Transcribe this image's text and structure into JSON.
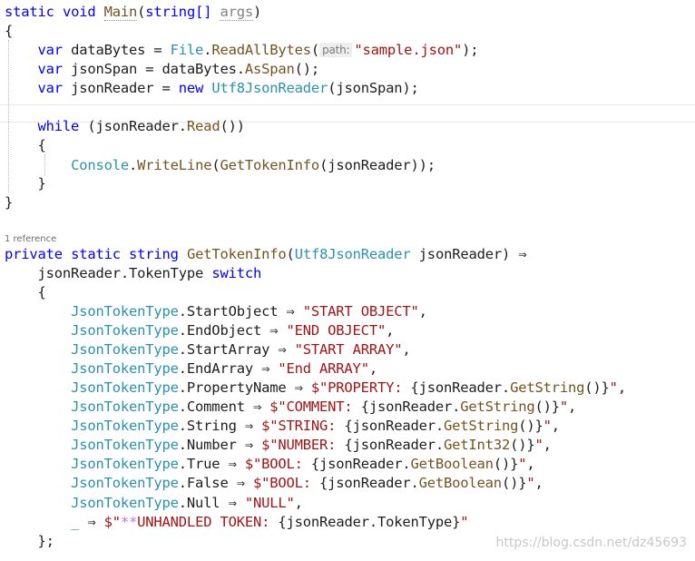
{
  "editor": {
    "main": {
      "sig": {
        "static": "static",
        "void": "void",
        "name": "Main",
        "open": "(",
        "type": "string[]",
        "param": "args",
        "close": ")"
      },
      "brace_open": "{",
      "l1": {
        "var": "var",
        "name": " dataBytes = ",
        "type": "File",
        "dot": ".",
        "method": "ReadAllBytes",
        "open": "(",
        "hint": "path:",
        "arg": "\"sample.json\"",
        "close": ");"
      },
      "l2": {
        "var": "var",
        "name": " jsonSpan = dataBytes.",
        "method": "AsSpan",
        "rest": "();"
      },
      "l3": {
        "var": "var",
        "name": " jsonReader = ",
        "new": "new",
        "type": "Utf8JsonReader",
        "rest": "(jsonSpan);"
      },
      "while": {
        "kw": "while",
        "open": " (jsonReader.",
        "method": "Read",
        "rest": "())"
      },
      "loop_open": "{",
      "console": {
        "type": "Console",
        "dot": ".",
        "method": "WriteLine",
        "open": "(",
        "call": "GetTokenInfo",
        "rest": "(jsonReader));"
      },
      "loop_close": "}",
      "brace_close": "}"
    },
    "codelens": "1 reference",
    "gti": {
      "sig": {
        "private": "private",
        "static": "static",
        "string": "string",
        "name": "GetTokenInfo",
        "open": "(",
        "type": "Utf8JsonReader",
        "rest": " jsonReader) ⇒"
      },
      "switch": {
        "expr": "jsonReader.TokenType ",
        "kw": "switch"
      },
      "open": "{",
      "arms": [
        {
          "type": "JsonTokenType",
          "member": ".StartObject ⇒ ",
          "prefix": "",
          "text": "\"START OBJECT\"",
          "tail": ","
        },
        {
          "type": "JsonTokenType",
          "member": ".EndObject ⇒ ",
          "prefix": "",
          "text": "\"END OBJECT\"",
          "tail": ","
        },
        {
          "type": "JsonTokenType",
          "member": ".StartArray ⇒ ",
          "prefix": "",
          "text": "\"START ARRAY\"",
          "tail": ","
        },
        {
          "type": "JsonTokenType",
          "member": ".EndArray ⇒ ",
          "prefix": "",
          "text": "\"End ARRAY\"",
          "tail": ","
        },
        {
          "type": "JsonTokenType",
          "member": ".PropertyName ⇒ ",
          "prefix": "$\"",
          "text": "PROPERTY: ",
          "expr_a": "{jsonReader.",
          "method": "GetString",
          "expr_b": "()}",
          "close": "\"",
          "tail": ","
        },
        {
          "type": "JsonTokenType",
          "member": ".Comment ⇒ ",
          "prefix": "$\"",
          "text": "COMMENT: ",
          "expr_a": "{jsonReader.",
          "method": "GetString",
          "expr_b": "()}",
          "close": "\"",
          "tail": ","
        },
        {
          "type": "JsonTokenType",
          "member": ".String ⇒ ",
          "prefix": "$\"",
          "text": "STRING: ",
          "expr_a": "{jsonReader.",
          "method": "GetString",
          "expr_b": "()}",
          "close": "\"",
          "tail": ","
        },
        {
          "type": "JsonTokenType",
          "member": ".Number ⇒ ",
          "prefix": "$\"",
          "text": "NUMBER: ",
          "expr_a": "{jsonReader.",
          "method": "GetInt32",
          "expr_b": "()}",
          "close": "\"",
          "tail": ","
        },
        {
          "type": "JsonTokenType",
          "member": ".True ⇒ ",
          "prefix": "$\"",
          "text": "BOOL: ",
          "expr_a": "{jsonReader.",
          "method": "GetBoolean",
          "expr_b": "()}",
          "close": "\"",
          "tail": ","
        },
        {
          "type": "JsonTokenType",
          "member": ".False ⇒ ",
          "prefix": "$\"",
          "text": "BOOL: ",
          "expr_a": "{jsonReader.",
          "method": "GetBoolean",
          "expr_b": "()}",
          "close": "\"",
          "tail": ","
        },
        {
          "type": "JsonTokenType",
          "member": ".Null ⇒ ",
          "prefix": "",
          "text": "\"NULL\"",
          "tail": ","
        }
      ],
      "default": {
        "discard": "_",
        "arrow": " ⇒ ",
        "prefix": "$\"",
        "escape": "**",
        "text": "UNHANDLED TOKEN: ",
        "expr": "{jsonReader.TokenType}",
        "close": "\""
      },
      "close": "};"
    }
  },
  "watermark": "https://blog.csdn.net/dz45693"
}
